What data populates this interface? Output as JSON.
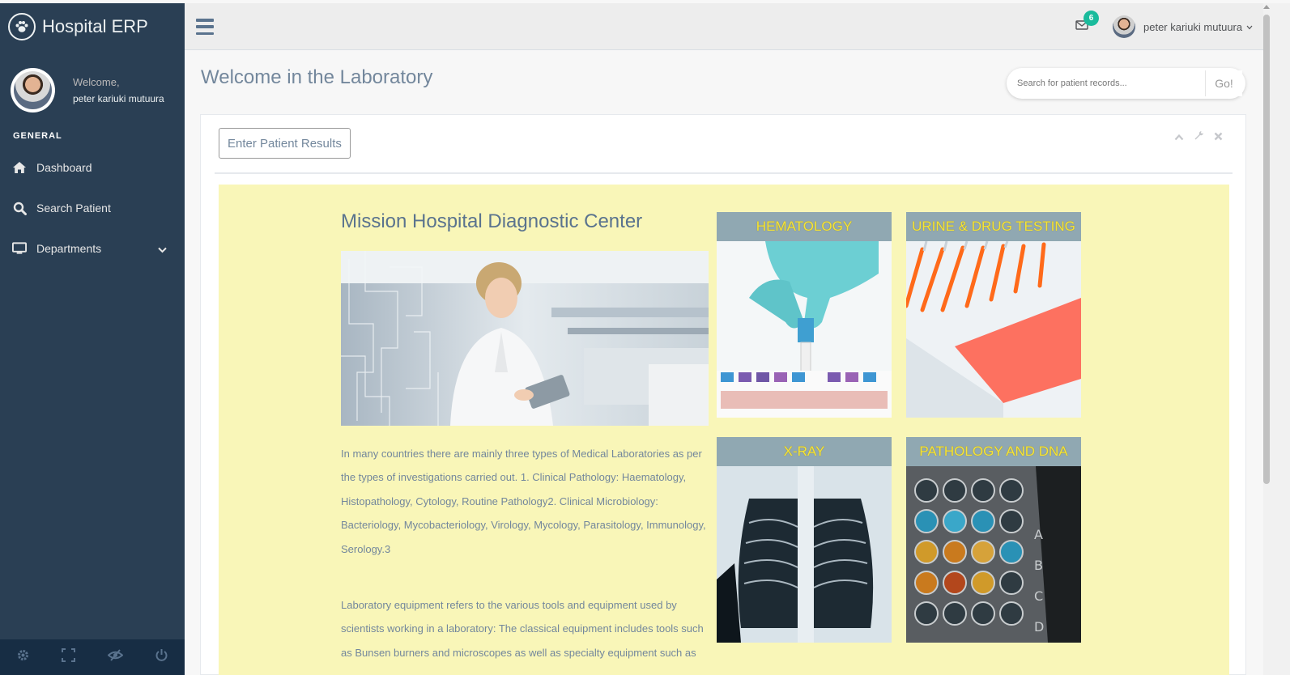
{
  "app": {
    "brand": "Hospital ERP"
  },
  "sidebar": {
    "welcome": "Welcome,",
    "user_name": "peter kariuki mutuura",
    "section": "GENERAL",
    "items": [
      {
        "label": "Dashboard",
        "icon": "home-icon"
      },
      {
        "label": "Search Patient",
        "icon": "search-icon"
      },
      {
        "label": "Departments",
        "icon": "desktop-icon"
      }
    ],
    "footer_icons": [
      "gear-icon",
      "fullscreen-icon",
      "eye-slash-icon",
      "power-icon"
    ]
  },
  "topnav": {
    "mail_count": "6",
    "user_name": "peter kariuki mutuura"
  },
  "page": {
    "title": "Welcome in the Laboratory",
    "search_placeholder": "Search for patient records...",
    "search_button": "Go!"
  },
  "panel": {
    "enter_button": "Enter Patient Results",
    "tools": [
      "chevron-up-icon",
      "wrench-icon",
      "close-icon"
    ]
  },
  "content": {
    "title": "Mission Hospital Diagnostic Center",
    "paragraph1": "In many countries there are mainly three types of Medical Laboratories as per the types of investigations carried out. 1. Clinical Pathology: Haematology, Histopathology, Cytology, Routine Pathology2. Clinical Microbiology: Bacteriology, Mycobacteriology, Virology, Mycology, Parasitology, Immunology, Serology.3",
    "paragraph2": "Laboratory equipment refers to the various tools and equipment used by scientists working in a laboratory: The classical equipment includes tools such as Bunsen burners and microscopes as well as specialty equipment such as",
    "tiles": [
      {
        "label": "HEMATOLOGY"
      },
      {
        "label": "URINE & DRUG TESTING"
      },
      {
        "label": "X-RAY"
      },
      {
        "label": "PATHOLOGY AND DNA"
      }
    ]
  },
  "colors": {
    "sidebar": "#2A3F54",
    "sidebar_footer": "#172D44",
    "content_bg": "#F9F6B8",
    "tile_label_bg": "#90A8B2",
    "tile_label_text": "#F4E33A",
    "badge": "#1ABB9C"
  }
}
